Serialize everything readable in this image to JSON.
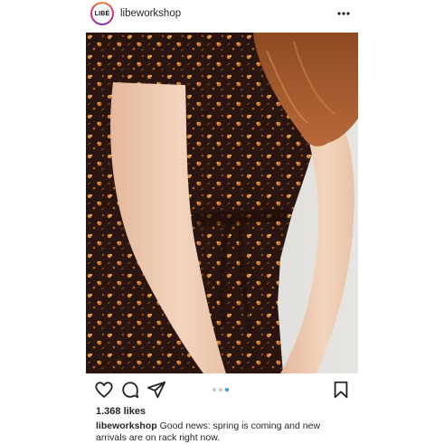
{
  "post": {
    "author": {
      "avatar_text": "LIBÉ",
      "username": "libeworkshop"
    },
    "photo": {
      "description_colors": {
        "dress": "#2a1510",
        "flowers": "#d48a3a",
        "skin": "#eecbb2",
        "hair": "#a25a2e",
        "background": "#d8d6d3"
      }
    },
    "carousel": {
      "count": 3,
      "active_index": 2
    },
    "likes_text": "1.368 likes",
    "caption": {
      "username": "libeworkshop",
      "text": "Good news: spring is coming and new arrivals are on rack right now."
    }
  },
  "icons": {
    "more": "more-horizontal-icon",
    "like": "heart-icon",
    "comment": "comment-icon",
    "share": "send-icon",
    "save": "bookmark-icon"
  }
}
